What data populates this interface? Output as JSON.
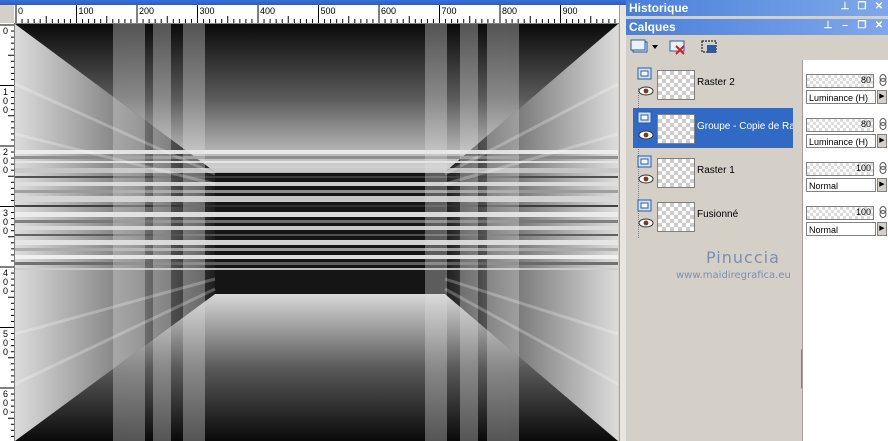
{
  "canvas": {
    "ruler_top_labels": [
      "0",
      "100",
      "200",
      "300",
      "400",
      "500",
      "600",
      "700",
      "800",
      "900"
    ],
    "ruler_left_labels": [
      "0",
      "1\n0\n0",
      "2\n0\n0",
      "3\n0\n0",
      "4\n0\n0",
      "5\n0\n0",
      "6\n0\n0"
    ]
  },
  "panels": {
    "history": {
      "title": "Historique"
    },
    "layers": {
      "title": "Calques",
      "items": [
        {
          "name": "Raster 2",
          "opacity": "80",
          "blend": "Luminance (H)",
          "selected": false
        },
        {
          "name": "Groupe - Copie de Ra",
          "opacity": "80",
          "blend": "Luminance (H)",
          "selected": true
        },
        {
          "name": "Raster 1",
          "opacity": "100",
          "blend": "Normal",
          "selected": false
        },
        {
          "name": "Fusionné",
          "opacity": "100",
          "blend": "Normal",
          "selected": false
        }
      ]
    }
  },
  "watermark": {
    "line1": "Pinuccia",
    "line2": "www.maidiregrafica.eu"
  },
  "icons": [
    "pin-icon",
    "restore-icon",
    "maximize-icon",
    "close-icon",
    "new-layer-icon",
    "delete-layer-icon",
    "mask-icon",
    "eye-icon",
    "link-icon",
    "dropdown-arrow-icon"
  ],
  "colors": {
    "title_bar": "#4a7fd8",
    "selection": "#316ac5",
    "panel_bg": "#d4d0c8"
  }
}
